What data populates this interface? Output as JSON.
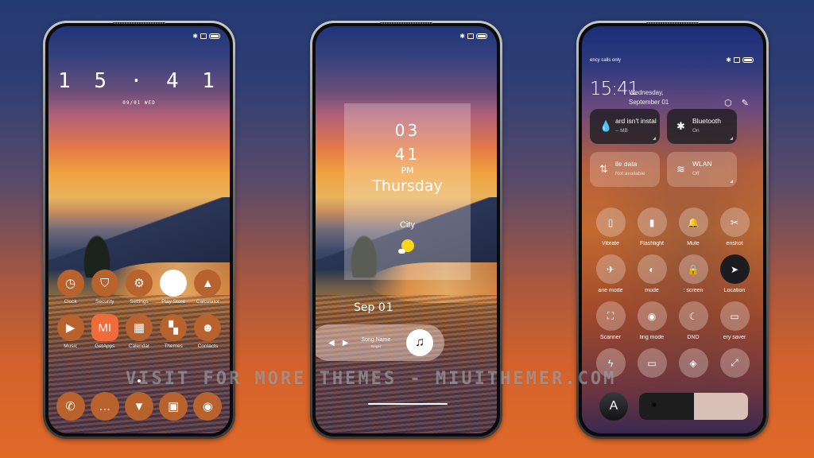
{
  "status_bar": {
    "bluetooth_icon": "bluetooth-icon",
    "sim_icon": "sim-icon",
    "battery_icon": "battery-icon"
  },
  "phone1": {
    "clock": "15:41",
    "clock_display": "1 5 · 4 1",
    "date": "09/01 WED",
    "apps": [
      {
        "label": "Clock",
        "icon": "clock-icon",
        "glyph": "◷"
      },
      {
        "label": "Security",
        "icon": "shield-icon",
        "glyph": "⛉"
      },
      {
        "label": "Settings",
        "icon": "gear-icon",
        "glyph": "⚙"
      },
      {
        "label": "Play Store",
        "icon": "play-store-icon",
        "glyph": "▶"
      },
      {
        "label": "Calculator",
        "icon": "calculator-icon",
        "glyph": "▲"
      },
      {
        "label": "Music",
        "icon": "music-icon",
        "glyph": "▶"
      },
      {
        "label": "GetApps",
        "icon": "getapps-icon",
        "glyph": "MI"
      },
      {
        "label": "Calendar",
        "icon": "calendar-icon",
        "glyph": "▦"
      },
      {
        "label": "Themes",
        "icon": "themes-icon",
        "glyph": "▚"
      },
      {
        "label": "Contacts",
        "icon": "contacts-icon",
        "glyph": "☻"
      }
    ],
    "dock": [
      {
        "icon": "phone-icon",
        "glyph": "✆"
      },
      {
        "icon": "messages-icon",
        "glyph": "…"
      },
      {
        "icon": "browser-icon",
        "glyph": "▼"
      },
      {
        "icon": "gallery-icon",
        "glyph": "▣"
      },
      {
        "icon": "camera-icon",
        "glyph": "◉"
      }
    ]
  },
  "phone2": {
    "hour": "03",
    "minute": "41",
    "ampm": "PM",
    "day": "Thursday",
    "city": "City",
    "date_month": "Sep",
    "date_day": "01",
    "music": {
      "song": "Song Name",
      "singer": "Singer",
      "prev": "◀",
      "next": "▶",
      "note": "♫"
    }
  },
  "phone3": {
    "carrier": "ency calls only",
    "time": "15:41",
    "date_line1": "Wednesday,",
    "date_line2": "September 01",
    "settings_glyph": "⬡",
    "edit_glyph": "✎",
    "tiles": [
      {
        "title": "ard isn't installed",
        "sub": "-- MB",
        "glyph": "💧",
        "style": "dark"
      },
      {
        "title": "Bluetooth",
        "sub": "On",
        "glyph": "✱",
        "style": "dark"
      },
      {
        "title": "ile data",
        "sub": "Not available",
        "glyph": "⇅",
        "style": "light"
      },
      {
        "title": "WLAN",
        "sub": "Off",
        "glyph": "≋",
        "style": "light"
      }
    ],
    "toggles": [
      {
        "label": "Vibrate",
        "icon": "vibrate-icon",
        "glyph": "▯",
        "on": false
      },
      {
        "label": "Flashlight",
        "icon": "flashlight-icon",
        "glyph": "▮",
        "on": false
      },
      {
        "label": "Mute",
        "icon": "bell-icon",
        "glyph": "🔔",
        "on": false
      },
      {
        "label": "enshot",
        "icon": "screenshot-icon",
        "glyph": "✂",
        "on": false
      },
      {
        "label": "ane mode",
        "icon": "airplane-icon",
        "glyph": "✈",
        "on": false
      },
      {
        "label": "mode",
        "icon": "dark-mode-icon",
        "glyph": "◐",
        "on": false
      },
      {
        "label": ": screen",
        "icon": "lock-icon",
        "glyph": "🔒",
        "on": false
      },
      {
        "label": "Location",
        "icon": "location-icon",
        "glyph": "➤",
        "on": true
      },
      {
        "label": "Scanner",
        "icon": "scanner-icon",
        "glyph": "⛶",
        "on": false
      },
      {
        "label": "ling mode",
        "icon": "eye-icon",
        "glyph": "◉",
        "on": false
      },
      {
        "label": "DND",
        "icon": "moon-icon",
        "glyph": "☾",
        "on": false
      },
      {
        "label": "ery saver",
        "icon": "battery-saver-icon",
        "glyph": "▭",
        "on": false
      },
      {
        "label": "",
        "icon": "lightning-icon",
        "glyph": "ϟ",
        "on": false
      },
      {
        "label": "",
        "icon": "cast-icon",
        "glyph": "▭",
        "on": false
      },
      {
        "label": "",
        "icon": "nearby-share-icon",
        "glyph": "◈",
        "on": false
      },
      {
        "label": "",
        "icon": "resize-icon",
        "glyph": "⤢",
        "on": false
      }
    ],
    "auto_brightness_label": "A",
    "brightness_percent": 50
  },
  "watermark": "VISIT FOR MORE THEMES - MIUITHEMER.COM"
}
